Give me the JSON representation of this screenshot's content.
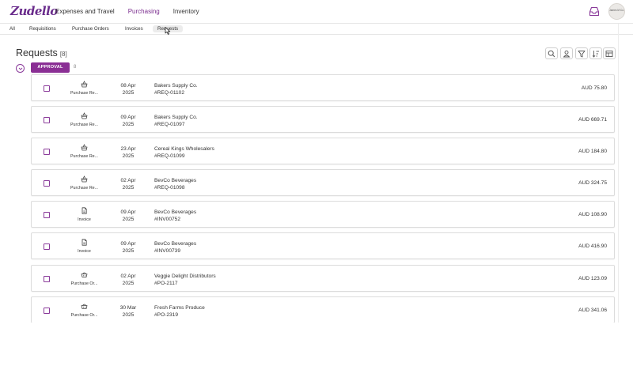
{
  "app": {
    "logo": "Zudello",
    "avatar_text": "James M Co."
  },
  "nav": {
    "items": [
      {
        "label": "Expenses and Travel",
        "active": false
      },
      {
        "label": "Purchasing",
        "active": true
      },
      {
        "label": "Inventory",
        "active": false
      }
    ]
  },
  "subnav": {
    "tabs": [
      {
        "label": "All"
      },
      {
        "label": "Requisitions"
      },
      {
        "label": "Purchase Orders"
      },
      {
        "label": "Invoices"
      },
      {
        "label": "Requests",
        "active": true
      }
    ]
  },
  "page": {
    "title": "Requests",
    "count": "[8]"
  },
  "toolbar": {
    "icons": [
      "search-icon",
      "user-icon",
      "filter-icon",
      "sort-icon",
      "columns-icon"
    ]
  },
  "group": {
    "label": "APPROVAL",
    "count": "8"
  },
  "rows": [
    {
      "icon": "basket-icon",
      "type": "Purchase Re...",
      "date_day": "08 Apr",
      "date_year": "2025",
      "supplier": "Bakers Supply Co.",
      "ref": "#REQ-01102",
      "amount": "AUD 75.80"
    },
    {
      "icon": "basket-icon",
      "type": "Purchase Re...",
      "date_day": "09 Apr",
      "date_year": "2025",
      "supplier": "Bakers Supply Co.",
      "ref": "#REQ-01097",
      "amount": "AUD 669.71"
    },
    {
      "icon": "basket-icon",
      "type": "Purchase Re...",
      "date_day": "23 Apr",
      "date_year": "2025",
      "supplier": "Cereal Kings Wholesalers",
      "ref": "#REQ-01099",
      "amount": "AUD 184.80"
    },
    {
      "icon": "basket-icon",
      "type": "Purchase Re...",
      "date_day": "02 Apr",
      "date_year": "2025",
      "supplier": "BevCo Beverages",
      "ref": "#REQ-01098",
      "amount": "AUD 324.75"
    },
    {
      "icon": "document-icon",
      "type": "Invoice",
      "date_day": "09 Apr",
      "date_year": "2025",
      "supplier": "BevCo Beverages",
      "ref": "#INV00752",
      "amount": "AUD 108.90"
    },
    {
      "icon": "document-icon",
      "type": "Invoice",
      "date_day": "09 Apr",
      "date_year": "2025",
      "supplier": "BevCo Beverages",
      "ref": "#INV00739",
      "amount": "AUD 416.90"
    },
    {
      "icon": "cart-icon",
      "type": "Purchase Or...",
      "date_day": "02 Apr",
      "date_year": "2025",
      "supplier": "Veggie Delight Distributors",
      "ref": "#PO-2117",
      "amount": "AUD 123.09"
    },
    {
      "icon": "cart-icon",
      "type": "Purchase Or...",
      "date_day": "30 Mar",
      "date_year": "2025",
      "supplier": "Fresh Farms Produce",
      "ref": "#PO-2319",
      "amount": "AUD 341.06"
    }
  ],
  "colors": {
    "brand": "#7a2c8e",
    "badge": "#8a2f94"
  }
}
